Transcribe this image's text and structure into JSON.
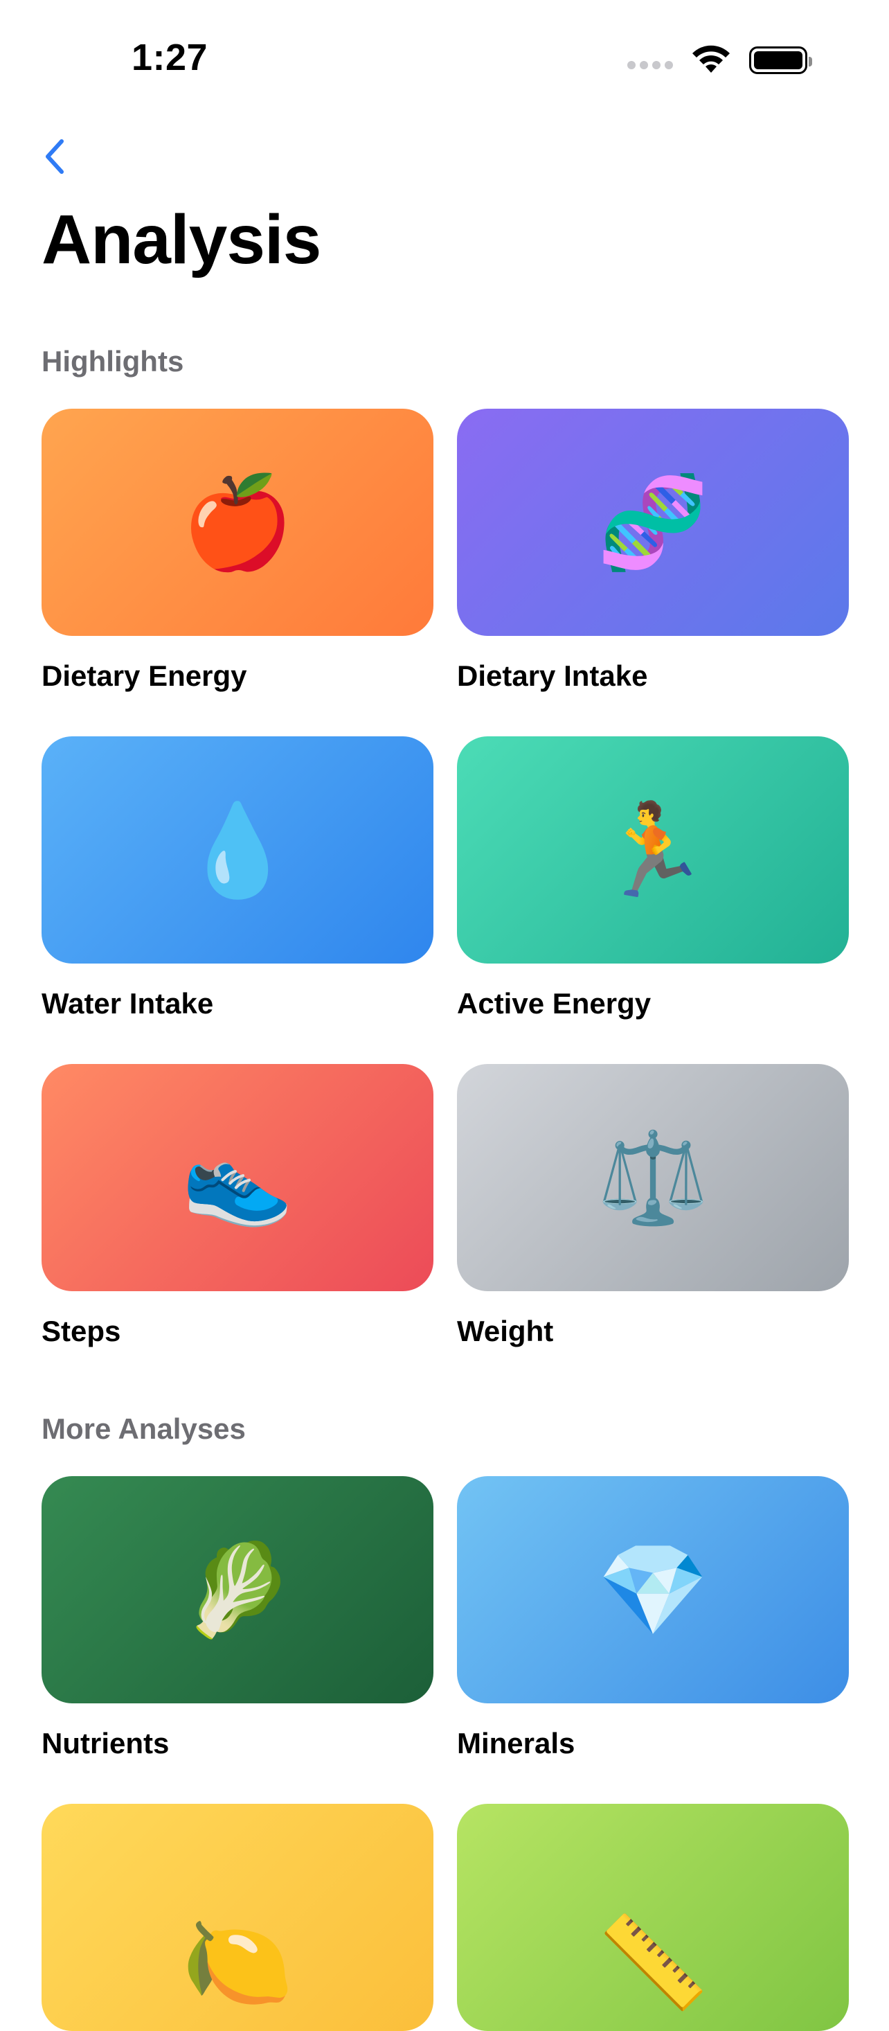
{
  "status_bar": {
    "time": "1:27"
  },
  "nav": {
    "back_icon": "chevron-left-icon"
  },
  "page": {
    "title": "Analysis"
  },
  "sections": [
    {
      "header": "Highlights",
      "cards": [
        {
          "label": "Dietary Energy",
          "emoji": "🍎",
          "icon": "apple-icon",
          "colors": [
            "#ffa54f",
            "#ff7a3a"
          ]
        },
        {
          "label": "Dietary Intake",
          "emoji": "🧬",
          "icon": "dna-icon",
          "colors": [
            "#8a6cf2",
            "#5b79ea"
          ]
        },
        {
          "label": "Water Intake",
          "emoji": "💧",
          "icon": "water-drop-icon",
          "colors": [
            "#5ab1f8",
            "#2f86ed"
          ]
        },
        {
          "label": "Active Energy",
          "emoji": "🏃",
          "icon": "runner-icon",
          "colors": [
            "#4cdcb6",
            "#22b195"
          ]
        },
        {
          "label": "Steps",
          "emoji": "👟",
          "icon": "sneaker-icon",
          "colors": [
            "#ff8a64",
            "#ec4b58"
          ]
        },
        {
          "label": "Weight",
          "emoji": "⚖️",
          "icon": "balance-scale-icon",
          "colors": [
            "#d2d5da",
            "#9ea4ab"
          ]
        }
      ]
    },
    {
      "header": "More Analyses",
      "cards": [
        {
          "label": "Nutrients",
          "emoji": "🥬",
          "icon": "leafy-green-icon",
          "colors": [
            "#358a52",
            "#1c5f38"
          ]
        },
        {
          "label": "Minerals",
          "emoji": "💎",
          "icon": "gem-icon",
          "colors": [
            "#72c3f4",
            "#3d8ee6"
          ]
        },
        {
          "label": "",
          "emoji": "🍋",
          "icon": "lemon-icon",
          "colors": [
            "#ffd95a",
            "#fbbf3b"
          ]
        },
        {
          "label": "",
          "emoji": "📏",
          "icon": "ruler-icon",
          "colors": [
            "#b6e463",
            "#80c543"
          ]
        }
      ]
    }
  ],
  "colors": {
    "accent": "#2f7bf5",
    "section_header": "#6d6d72",
    "background": "#ffffff"
  }
}
